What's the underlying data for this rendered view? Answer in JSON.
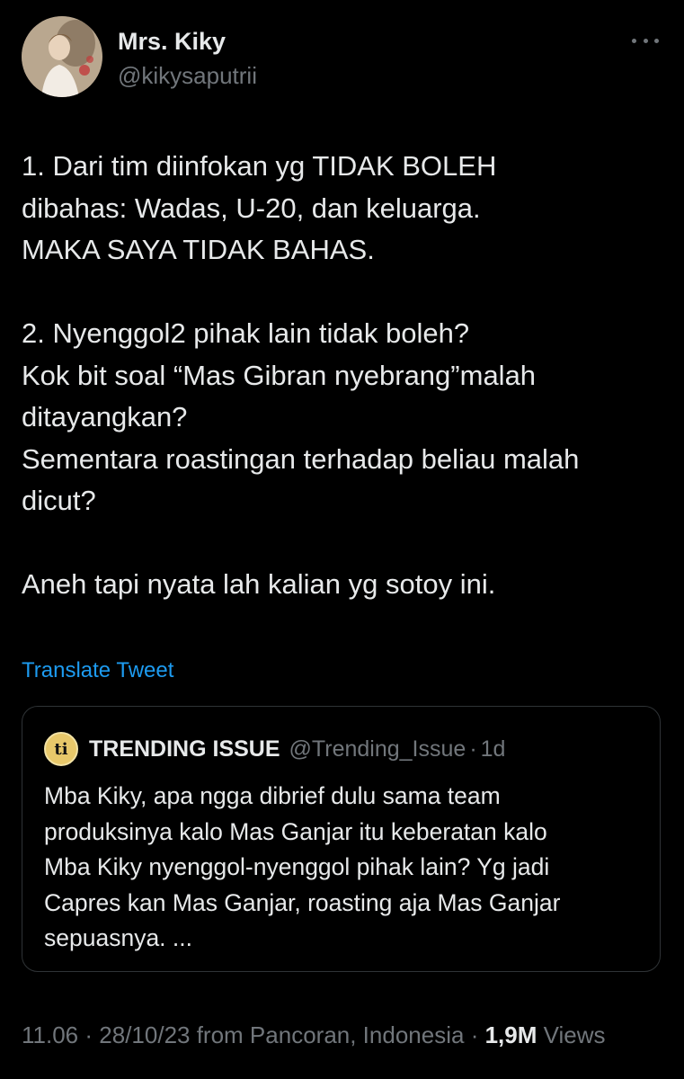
{
  "author": {
    "name": "Mrs. Kiky",
    "handle": "@kikysaputrii"
  },
  "tweet": {
    "lines": [
      "1. Dari tim diinfokan yg TIDAK BOLEH",
      "dibahas: Wadas, U-20, dan keluarga.",
      "MAKA SAYA TIDAK BAHAS.",
      "",
      "2. Nyenggol2 pihak lain tidak boleh?",
      "Kok bit soal “Mas Gibran nyebrang”malah",
      "ditayangkan?",
      "Sementara roastingan terhadap beliau malah",
      "dicut?",
      "",
      "Aneh tapi nyata lah kalian yg sotoy ini."
    ]
  },
  "translate_label": "Translate Tweet",
  "quote": {
    "avatar_text": "ti",
    "name": "TRENDING ISSUE",
    "handle": "@Trending_Issue",
    "separator": "·",
    "time": "1d",
    "lines": [
      "Mba Kiky, apa ngga dibrief dulu sama team",
      "produksinya kalo Mas Ganjar itu keberatan kalo",
      "Mba Kiky nyenggol-nyenggol pihak lain? Yg jadi",
      "Capres kan Mas Ganjar, roasting aja Mas Ganjar",
      "sepuasnya. ..."
    ]
  },
  "meta": {
    "time": "11.06",
    "separator": "·",
    "date": "28/10/23 from Pancoran, Indonesia",
    "views_count": "1,9M",
    "views_label": "Views"
  },
  "icons": {
    "more": "more-horizontal-icon",
    "quote_avatar": "trending-issue-logo"
  },
  "colors": {
    "background": "#000000",
    "text": "#e7e9ea",
    "secondary": "#71767b",
    "link": "#1d9bf0",
    "border": "#2f3336"
  }
}
